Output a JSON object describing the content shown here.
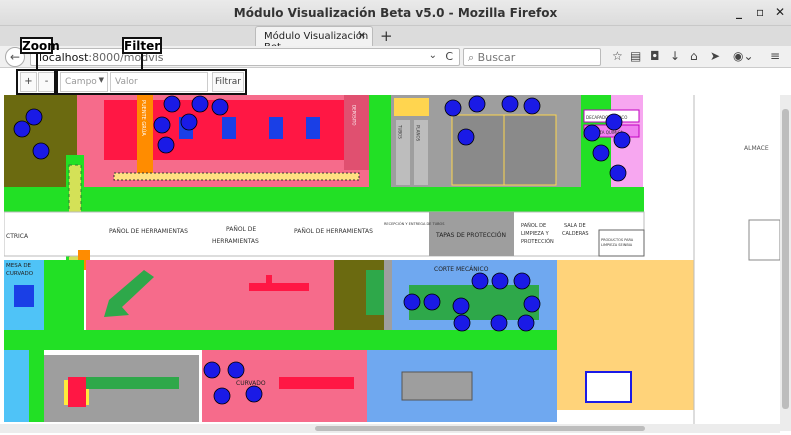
{
  "window": {
    "title": "Módulo Visualización Beta v5.0 - Mozilla Firefox",
    "minimize": "_",
    "maximize": "▫",
    "close": "✕"
  },
  "tab": {
    "label": "Módulo Visualización Bet...",
    "close": "×",
    "new_tab": "+"
  },
  "navbar": {
    "back": "←",
    "url_host": "localhost",
    "url_rest": ":8000/modvis",
    "url_dropdown": "⌄",
    "reload": "C",
    "search_placeholder": "Buscar"
  },
  "controls": {
    "zoom_in": "+",
    "zoom_out": "-",
    "campo_placeholder": "Campo",
    "valor_placeholder": "Valor",
    "filtrar": "Filtrar"
  },
  "callouts": {
    "zoom": "Zoom",
    "filter": "Filter"
  },
  "map_labels": {
    "panol_herramientas_1": "PAÑOL DE HERRAMIENTAS",
    "panol_de": "PAÑOL DE",
    "herramientas": "HERRAMIENTAS",
    "panol_herramientas_2": "PAÑOL DE HERRAMIENTAS",
    "tapas": "TAPAS DE PROTECCIÓN",
    "panol_limpieza_1": "PAÑOL DE",
    "panol_limpieza_2": "LIMPIEZA Y",
    "panol_limpieza_3": "PROTECCIÓN",
    "sala_1": "SALA DE",
    "sala_2": "CALDERAS",
    "productos_1": "PRODUCTOS PARA",
    "productos_2": "LIMPIEZA SEINBIA",
    "electrica": "CTRICA",
    "mesa_1": "MESA DE",
    "mesa_2": "CURVADO",
    "corte": "CORTE MECÁNICO",
    "curvado": "CURVADO",
    "almace": "ALMACE",
    "puente_grua": "PUENTE GRÚA",
    "recepcion": "RECEPCIÓN Y ENTREGA DE TUBOS",
    "tubos": "TUBOS",
    "planos": "PLANOS",
    "deposito": "DEPOSITO",
    "pink_1": "DECAPADO QUIMICO",
    "pink_2": "LIMPIEZA QUIMICA"
  },
  "markers_count": 40,
  "colors": {
    "green": "#22e025",
    "pink": "#f66b8b",
    "red": "#ff1744",
    "blue_marker": "#1a1ae6",
    "gray": "#9e9e9e",
    "olive": "#6b6a10",
    "orange": "#ff8c00",
    "yellow": "#ffd54f",
    "light_blue": "#6fa8f0",
    "peach": "#ffd37a",
    "cyan": "#4fc3f7",
    "magenta": "#f7a7f0"
  }
}
